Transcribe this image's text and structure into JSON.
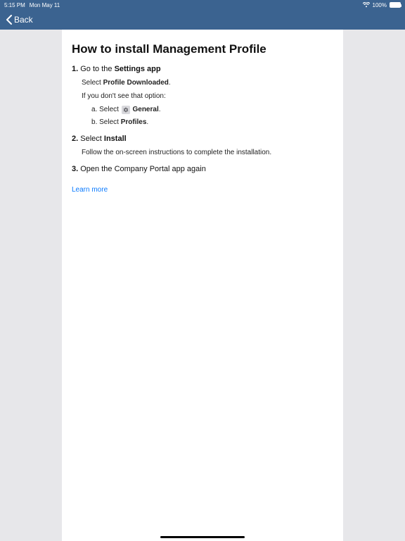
{
  "status": {
    "time": "5:15 PM",
    "date": "Mon May 11",
    "battery_pct": "100%"
  },
  "nav": {
    "back_label": "Back"
  },
  "page": {
    "title": "How to install Management Profile",
    "steps": [
      {
        "prefix": "Go to the ",
        "bold": "Settings app",
        "suffix": "",
        "detail_prefix": "Select ",
        "detail_bold": "Profile Downloaded",
        "detail_suffix": ".",
        "note": "If you don't see that option:",
        "subitems": [
          {
            "prefix": "Select ",
            "icon": "gear",
            "bold": "General",
            "suffix": "."
          },
          {
            "prefix": "Select ",
            "bold": "Profiles",
            "suffix": "."
          }
        ]
      },
      {
        "prefix": "Select ",
        "bold": "Install",
        "suffix": "",
        "detail_plain": "Follow the on-screen instructions to complete the installation."
      },
      {
        "prefix": "Open the Company Portal app again",
        "bold": "",
        "suffix": ""
      }
    ],
    "learn_more": "Learn more"
  }
}
